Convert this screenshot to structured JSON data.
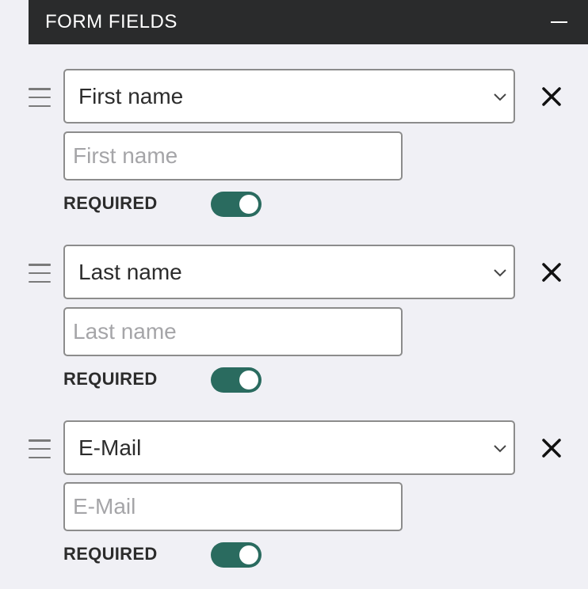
{
  "panel": {
    "title": "FORM FIELDS"
  },
  "fields": [
    {
      "type": "First name",
      "placeholder": "First name",
      "required_label": "REQUIRED",
      "required": true
    },
    {
      "type": "Last name",
      "placeholder": "Last name",
      "required_label": "REQUIRED",
      "required": true
    },
    {
      "type": "E-Mail",
      "placeholder": "E-Mail",
      "required_label": "REQUIRED",
      "required": true
    }
  ],
  "colors": {
    "header_bg": "#2a2b2c",
    "toggle_on": "#2a6b5f",
    "page_bg": "#f0f0f5"
  },
  "icons": {
    "drag": "drag-handle-icon",
    "remove": "close-icon",
    "dropdown": "chevron-down-icon",
    "collapse": "minus-icon"
  }
}
